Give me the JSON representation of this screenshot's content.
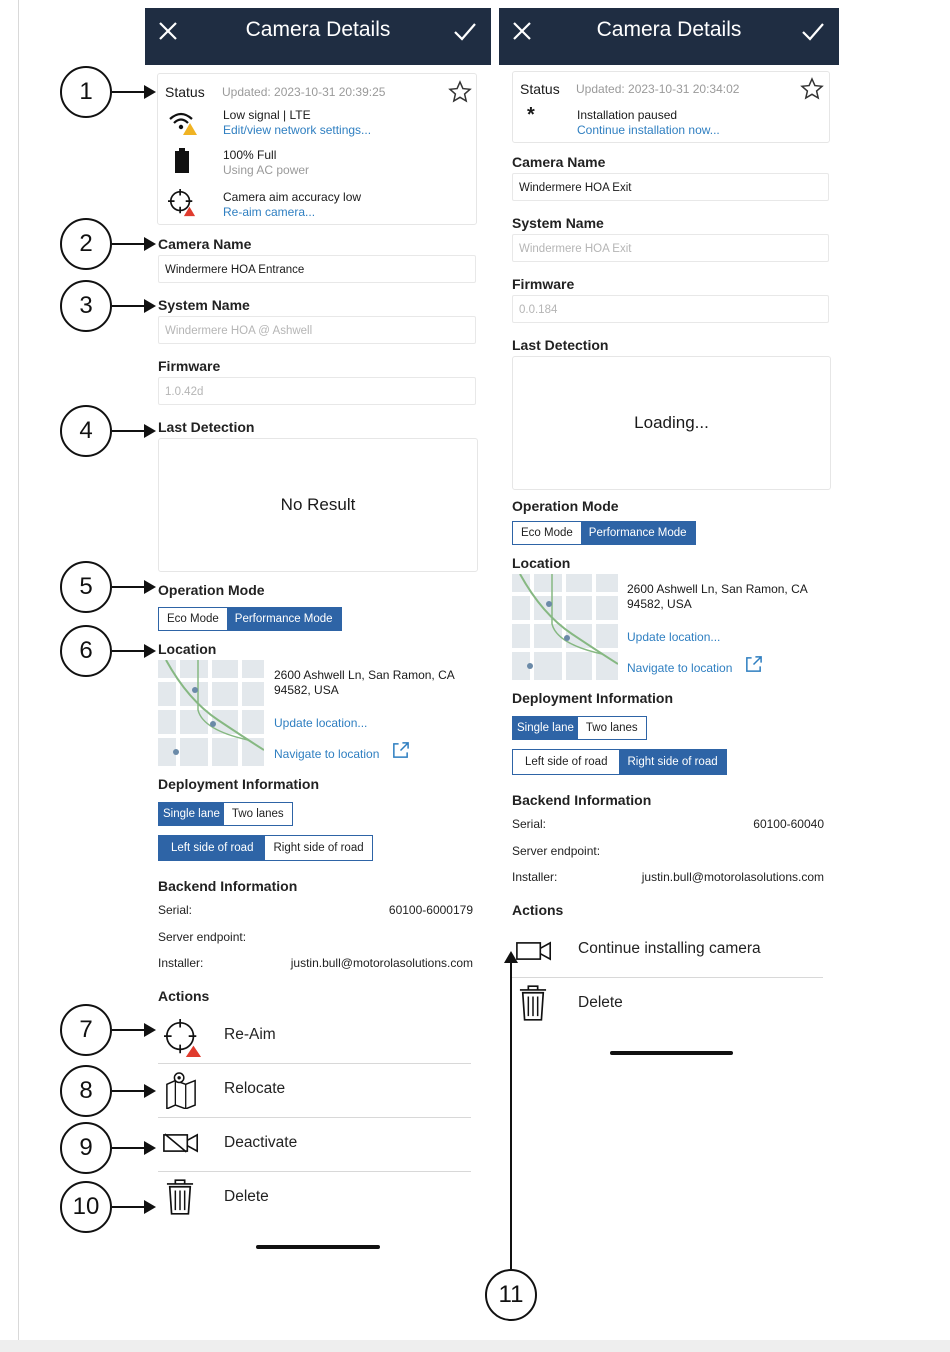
{
  "callouts": [
    "1",
    "2",
    "3",
    "4",
    "5",
    "6",
    "7",
    "8",
    "9",
    "10",
    "11"
  ],
  "left": {
    "header": {
      "title": "Camera Details"
    },
    "status": {
      "label": "Status",
      "updated": "Updated: 2023-10-31 20:39:25",
      "signal_title": "Low signal | LTE",
      "signal_link": "Edit/view network settings...",
      "battery_title": "100% Full",
      "battery_sub": "Using AC power",
      "aim_title": "Camera aim accuracy low",
      "aim_link": "Re-aim camera..."
    },
    "camera_name": {
      "label": "Camera Name",
      "value": "Windermere HOA Entrance"
    },
    "system_name": {
      "label": "System Name",
      "value": "Windermere HOA @ Ashwell"
    },
    "firmware": {
      "label": "Firmware",
      "value": "1.0.42d"
    },
    "last_detection": {
      "label": "Last Detection",
      "text": "No Result"
    },
    "operation_mode": {
      "label": "Operation Mode",
      "eco": "Eco Mode",
      "performance": "Performance Mode",
      "selected": "Performance Mode"
    },
    "location": {
      "label": "Location",
      "address": "2600 Ashwell Ln, San Ramon, CA 94582, USA",
      "update_link": "Update location...",
      "navigate_link": "Navigate to location"
    },
    "deployment": {
      "label": "Deployment Information",
      "single": "Single lane",
      "two": "Two lanes",
      "left_side": "Left side of road",
      "right_side": "Right side of road"
    },
    "backend": {
      "label": "Backend Information",
      "serial_label": "Serial:",
      "serial": "60100-6000179",
      "endpoint_label": "Server endpoint:",
      "installer_label": "Installer:",
      "installer": "justin.bull@motorolasolutions.com"
    },
    "actions": {
      "label": "Actions",
      "reaim": "Re-Aim",
      "relocate": "Relocate",
      "deactivate": "Deactivate",
      "delete": "Delete"
    }
  },
  "right": {
    "header": {
      "title": "Camera Details"
    },
    "status": {
      "label": "Status",
      "updated": "Updated: 2023-10-31 20:34:02",
      "install_title": "Installation paused",
      "install_link": "Continue installation now..."
    },
    "camera_name": {
      "label": "Camera Name",
      "value": "Windermere HOA Exit"
    },
    "system_name": {
      "label": "System Name",
      "value": "Windermere HOA Exit"
    },
    "firmware": {
      "label": "Firmware",
      "value": "0.0.184"
    },
    "last_detection": {
      "label": "Last Detection",
      "text": "Loading..."
    },
    "operation_mode": {
      "label": "Operation Mode",
      "eco": "Eco Mode",
      "performance": "Performance Mode",
      "selected": "Performance Mode"
    },
    "location": {
      "label": "Location",
      "address": "2600 Ashwell Ln, San Ramon, CA 94582, USA",
      "update_link": "Update location...",
      "navigate_link": "Navigate to location"
    },
    "deployment": {
      "label": "Deployment Information",
      "single": "Single lane",
      "two": "Two lanes",
      "left_side": "Left side of road",
      "right_side": "Right side of road"
    },
    "backend": {
      "label": "Backend Information",
      "serial_label": "Serial:",
      "serial": "60100-60040",
      "endpoint_label": "Server endpoint:",
      "installer_label": "Installer:",
      "installer": "justin.bull@motorolasolutions.com"
    },
    "actions": {
      "label": "Actions",
      "continue": "Continue installing camera",
      "delete": "Delete"
    }
  },
  "colors": {
    "header_bg": "#1f2d42",
    "accent": "#2e64a6",
    "link": "#2f7fc1",
    "warning": "#e03b2e",
    "signal_warning": "#f0b323"
  }
}
